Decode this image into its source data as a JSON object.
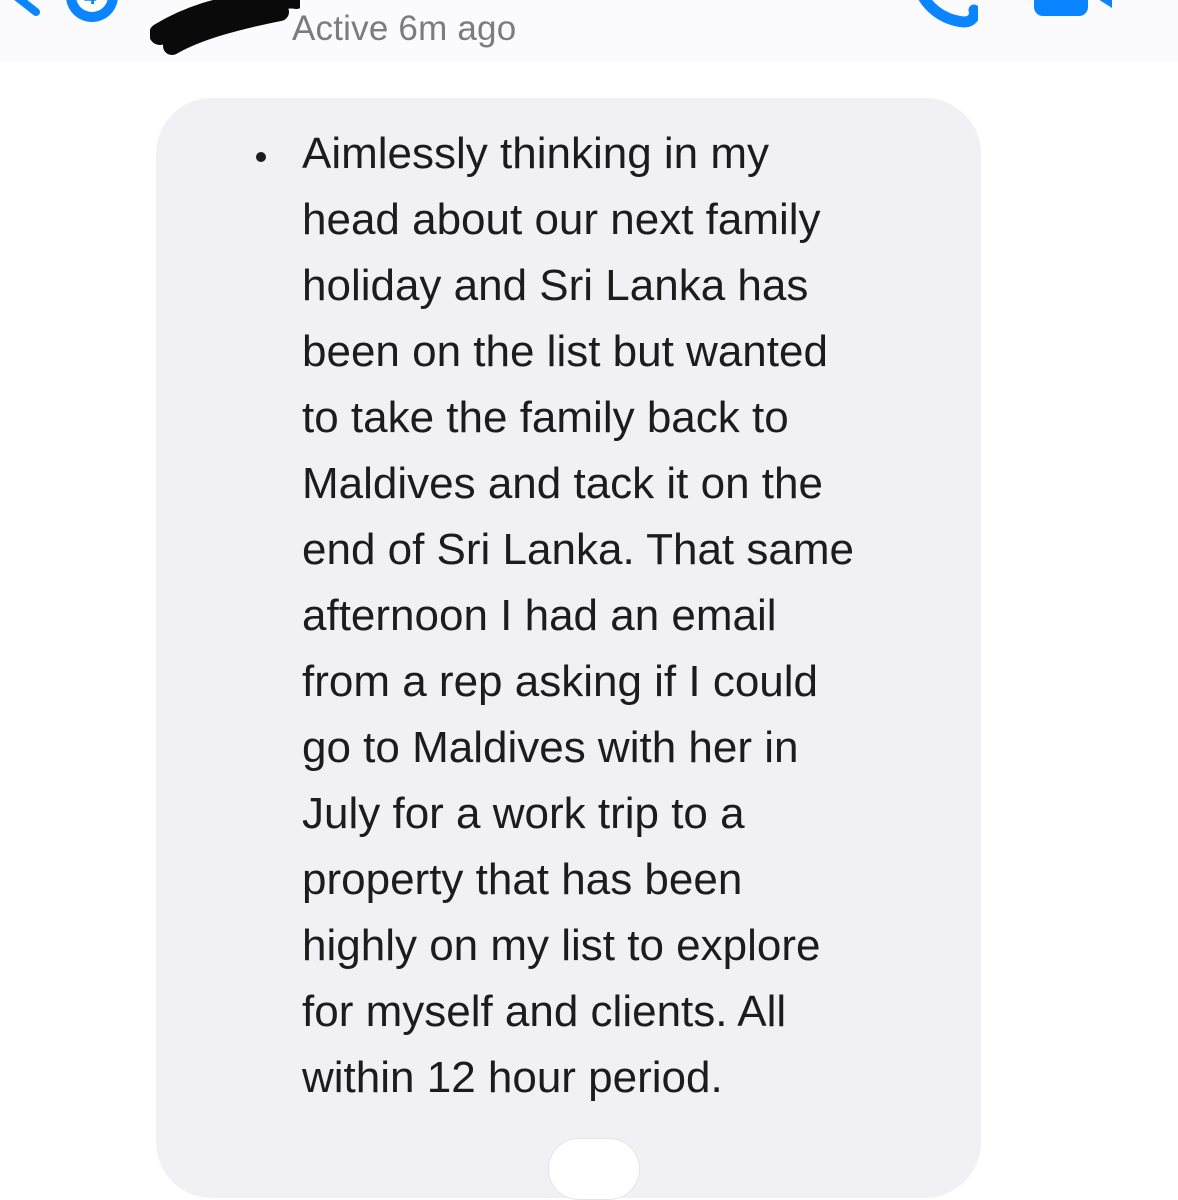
{
  "header": {
    "status": "Active 6m ago",
    "icons": {
      "back": "chevron-back-icon",
      "phone": "phone-icon",
      "video": "video-icon"
    },
    "accent_color": "#0a84ff"
  },
  "message": {
    "bubble_color": "#f0f0f5",
    "text_color": "#1c1c1e",
    "lines": [
      "Aimlessly thinking in my",
      "head about our next family",
      "holiday and Sri Lanka has",
      "been on the list but wanted",
      "to take the family back to",
      "Maldives and tack it on the",
      "end of Sri Lanka. That same",
      "afternoon I had an email",
      "from a rep asking if I could",
      "go to Maldives with her in",
      "July for a work trip to a",
      "property that has been",
      "highly on my list to explore",
      "for myself and clients. All",
      "within 12 hour period."
    ]
  }
}
